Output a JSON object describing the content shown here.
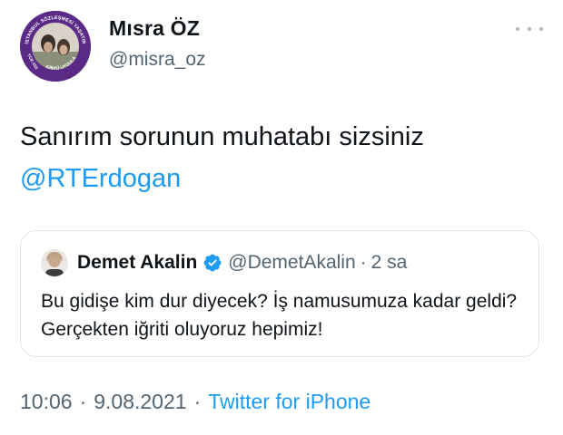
{
  "author": {
    "display_name": "Mısra ÖZ",
    "handle": "@misra_oz",
    "avatar_ring_text_top": "İSTANBUL SÖZLEŞMESİ YAŞATIR",
    "avatar_ring_text_bottom": "6284'Ü UYGULA",
    "avatar_ring_text_left": "TCK-103"
  },
  "tweet": {
    "text": "Sanırım sorunun muhatabı sizsiniz",
    "mention": "@RTErdogan"
  },
  "quote": {
    "display_name": "Demet Akalin",
    "handle": "@DemetAkalin",
    "separator": "·",
    "time": "2 sa",
    "text": "Bu gidişe kim dur diyecek? İş namusumuza kadar geldi? Gerçekten iğriti oluyoruz hepimiz!"
  },
  "meta": {
    "time": "10:06",
    "sep1": "·",
    "date": "9.08.2021",
    "sep2": "·",
    "source": "Twitter for iPhone"
  },
  "colors": {
    "link": "#1d9bf0",
    "secondary": "#536471",
    "avatar_ring": "#5b2a86"
  },
  "icons": {
    "more": "more-horizontal-icon",
    "verified": "verified-badge-icon"
  }
}
